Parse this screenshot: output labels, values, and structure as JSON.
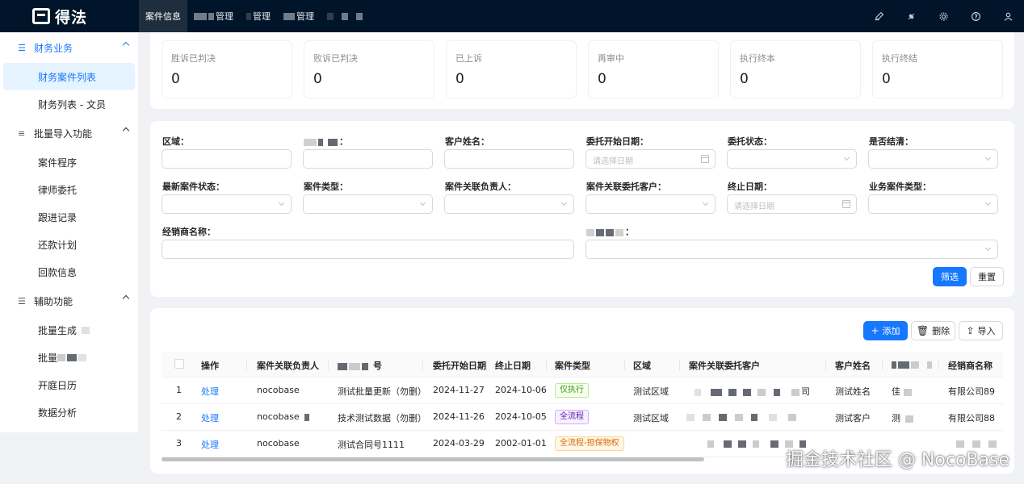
{
  "header": {
    "logo_text": "得法",
    "nav": [
      {
        "label": "案件信息"
      },
      {
        "label": "管理"
      },
      {
        "label": "管理"
      },
      {
        "label": "管理"
      }
    ],
    "icons": [
      "pen-icon",
      "plugin-icon",
      "settings-icon",
      "help-icon",
      "user-icon"
    ]
  },
  "sidebar": {
    "groups": [
      {
        "label": "财务业务",
        "items": [
          "财务案件列表",
          "财务列表 - 文员"
        ]
      },
      {
        "label": "批量导入功能",
        "items": [
          "案件程序",
          "律师委托",
          "跟进记录",
          "还款计划",
          "回款信息"
        ]
      },
      {
        "label": "辅助功能",
        "items": [
          "批量生成",
          "批量",
          "开庭日历",
          "数据分析"
        ]
      }
    ]
  },
  "stats": [
    {
      "title": "胜诉已判决",
      "value": "0"
    },
    {
      "title": "败诉已判决",
      "value": "0"
    },
    {
      "title": "已上诉",
      "value": "0"
    },
    {
      "title": "再审中",
      "value": "0"
    },
    {
      "title": "执行终本",
      "value": "0"
    },
    {
      "title": "执行终结",
      "value": "0"
    }
  ],
  "filters": {
    "region": "区域：",
    "hidden1": "：",
    "customer_name": "客户姓名：",
    "start_date": "委托开始日期：",
    "status": "委托状态：",
    "settled": "是否结清：",
    "latest_status": "最新案件状态：",
    "case_type": "案件类型：",
    "owner": "案件关联负责人：",
    "client": "案件关联委托客户：",
    "end_date": "终止日期：",
    "biz_type": "业务案件类型：",
    "dealer": "经销商名称：",
    "hidden2": "：",
    "date_placeholder": "请选择日期",
    "filter_btn": "筛选",
    "reset_btn": "重置"
  },
  "actions": {
    "add": "添加",
    "delete": "删除",
    "import": "导入"
  },
  "table": {
    "headers": [
      "操作",
      "案件关联负责人",
      "号",
      "委托开始日期",
      "终止日期",
      "案件类型",
      "区域",
      "案件关联委托客户",
      "客户姓名",
      "",
      "经销商名称"
    ],
    "rows": [
      {
        "idx": "1",
        "action": "处理",
        "owner": "nocobase",
        "contract": "测试批量更新（勿删）",
        "start": "2024-11-27",
        "end": "2024-10-06",
        "type": "仅执行",
        "type_color": "green",
        "region": "测试区域",
        "client": "司",
        "customer": "测试姓名",
        "extra": "佳",
        "dealer": "有限公司89"
      },
      {
        "idx": "2",
        "action": "处理",
        "owner": "nocobase",
        "contract": "技术测试数据（勿删）",
        "start": "2024-11-26",
        "end": "2024-10-05",
        "type": "全流程",
        "type_color": "purple",
        "region": "测试区域",
        "client": "",
        "customer": "测试客户",
        "extra": "测",
        "dealer": "有限公司88"
      },
      {
        "idx": "3",
        "action": "处理",
        "owner": "nocobase",
        "contract": "测试合同号1111",
        "start": "2024-03-29",
        "end": "2002-01-01",
        "type": "全流程-担保物权",
        "type_color": "orange",
        "region": "",
        "client": "",
        "customer": "",
        "extra": "",
        "dealer": ""
      }
    ]
  },
  "watermark": "掘金技术社区 @ NocoBase"
}
